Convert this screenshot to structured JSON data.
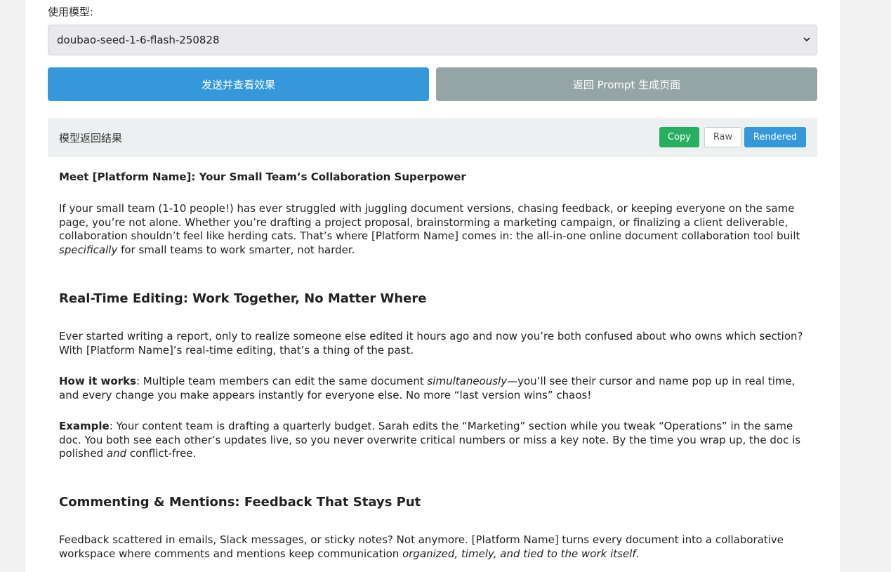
{
  "form": {
    "model_label": "使用模型:",
    "model_value": "doubao-seed-1-6-flash-250828",
    "send_button": "发送并查看效果",
    "back_button": "返回 Prompt 生成页面"
  },
  "result": {
    "title": "模型返回结果",
    "copy_label": "Copy",
    "raw_label": "Raw",
    "rendered_label": "Rendered"
  },
  "doc": {
    "title": "Meet [Platform Name]: Your Small Team’s Collaboration Superpower",
    "p1_a": "If your small team (1-10 people!) has ever struggled with juggling document versions, chasing feedback, or keeping everyone on the same page, you’re not alone. Whether you’re drafting a project proposal, brainstorming a marketing campaign, or finalizing a client deliverable, collaboration shouldn’t feel like herding cats. That’s where [Platform Name] comes in: the all-in-one online document collaboration tool built ",
    "p1_em": "specifically",
    "p1_b": " for small teams to work smarter, not harder.",
    "h2_realtime": "Real-Time Editing: Work Together, No Matter Where",
    "p2": "Ever started writing a report, only to realize someone else edited it hours ago and now you’re both confused about who owns which section? With [Platform Name]’s real-time editing, that’s a thing of the past.",
    "p3_strong": "How it works",
    "p3_a": ": Multiple team members can edit the same document ",
    "p3_em": "simultaneously",
    "p3_b": "—you’ll see their cursor and name pop up in real time, and every change you make appears instantly for everyone else. No more “last version wins” chaos!",
    "p4_strong": "Example",
    "p4_a": ": Your content team is drafting a quarterly budget. Sarah edits the “Marketing” section while you tweak “Operations” in the same doc. You both see each other’s updates live, so you never overwrite critical numbers or miss a key note. By the time you wrap up, the doc is polished ",
    "p4_em": "and",
    "p4_b": " conflict-free.",
    "h2_comments": "Commenting & Mentions: Feedback That Stays Put",
    "p5_a": "Feedback scattered in emails, Slack messages, or sticky notes? Not anymore. [Platform Name] turns every document into a collaborative workspace where comments and mentions keep communication ",
    "p5_em": "organized, timely, and tied to the work itself",
    "p5_b": "."
  }
}
